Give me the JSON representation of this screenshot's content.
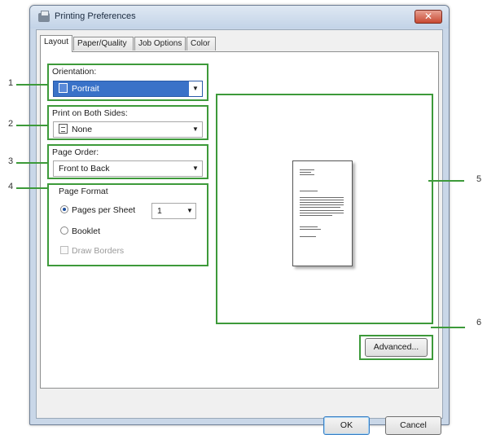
{
  "window": {
    "title": "Printing Preferences",
    "close_glyph": "✕"
  },
  "tabs": [
    {
      "label": "Layout",
      "active": true
    },
    {
      "label": "Paper/Quality",
      "active": false
    },
    {
      "label": "Job Options",
      "active": false
    },
    {
      "label": "Color",
      "active": false
    }
  ],
  "orientation": {
    "label": "Orientation:",
    "value": "Portrait",
    "icon": "portrait-icon"
  },
  "duplex": {
    "label": "Print on Both Sides:",
    "value": "None",
    "icon": "document-icon"
  },
  "page_order": {
    "label": "Page Order:",
    "value": "Front to Back"
  },
  "page_format": {
    "label": "Page Format",
    "pages_per_sheet_label": "Pages per Sheet",
    "pages_per_sheet_value": "1",
    "booklet_label": "Booklet",
    "draw_borders_label": "Draw Borders",
    "selected": "pages_per_sheet"
  },
  "buttons": {
    "advanced": "Advanced...",
    "ok": "OK",
    "cancel": "Cancel"
  },
  "callouts": [
    "1",
    "2",
    "3",
    "4",
    "5",
    "6"
  ],
  "dropdown_arrow": "▼",
  "colors": {
    "highlight_green": "#3d9a3a",
    "selection_blue": "#3a72c8"
  }
}
